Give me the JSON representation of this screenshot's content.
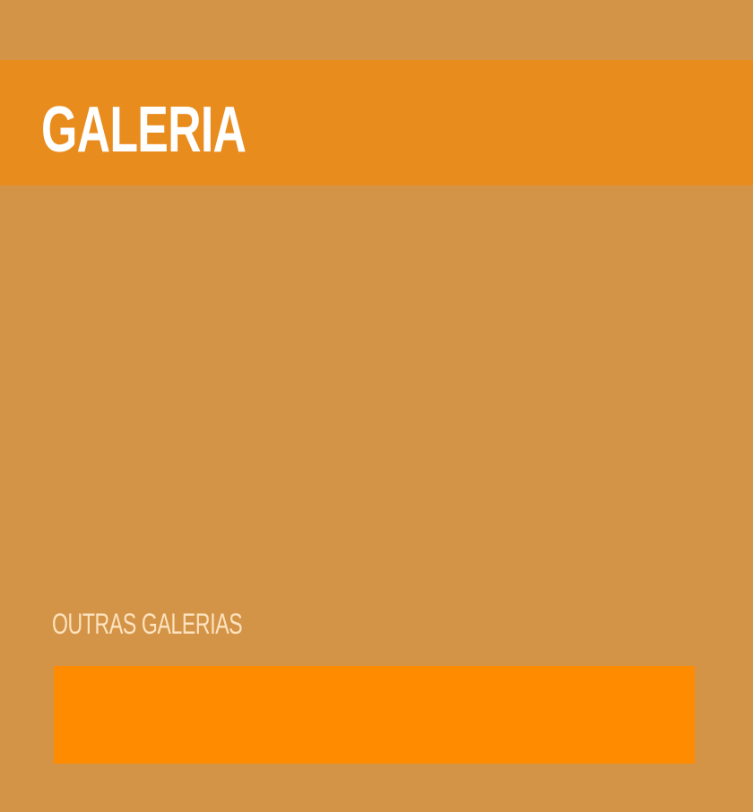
{
  "header": {
    "title": "GALERIA"
  },
  "other_galleries": {
    "heading": "OUTRAS GALERIAS"
  },
  "colors": {
    "background": "#d49448",
    "title_bar": "#e98c1e",
    "accent_card": "#ff8c00",
    "heading_text": "#fde3bf",
    "title_text": "#ffffff"
  }
}
